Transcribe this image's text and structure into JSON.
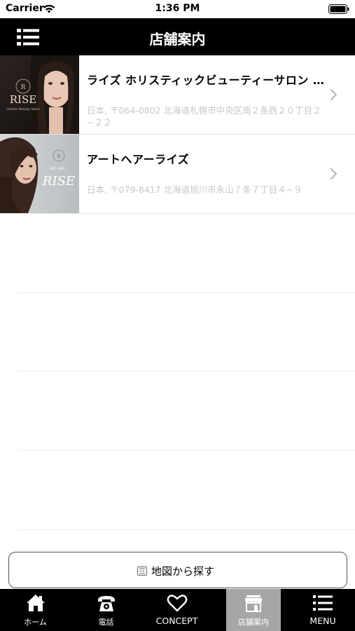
{
  "status_bar": {
    "carrier": "Carrier",
    "time": "1:36 PM"
  },
  "navbar": {
    "title": "店舗案内"
  },
  "stores": [
    {
      "name": "ライズ ホリスティックビューティーサロン 札…",
      "address": "日本, 〒064-0802 北海道札幌市中央区南２条西２０丁目２−２２",
      "logo": "RISE",
      "logo_sub": "Holistic Beauty Salon"
    },
    {
      "name": "アートヘアーライズ",
      "address": "日本, 〒079-8417 北海道旭川市永山７条７丁目４−９",
      "logo": "RISE",
      "logo_sub": "ART HAIR"
    }
  ],
  "map_button": {
    "label": "地図から探す",
    "icon": "map-icon"
  },
  "tabs": [
    {
      "label": "ホーム",
      "icon": "home-icon"
    },
    {
      "label": "電話",
      "icon": "phone-icon"
    },
    {
      "label": "CONCEPT",
      "icon": "heart-icon"
    },
    {
      "label": "店舗案内",
      "icon": "store-icon",
      "active": true
    },
    {
      "label": "MENU",
      "icon": "list-icon"
    }
  ],
  "colors": {
    "bar": "#000000",
    "active_tab": "#a6a6a6",
    "address": "#c7c7cc"
  }
}
